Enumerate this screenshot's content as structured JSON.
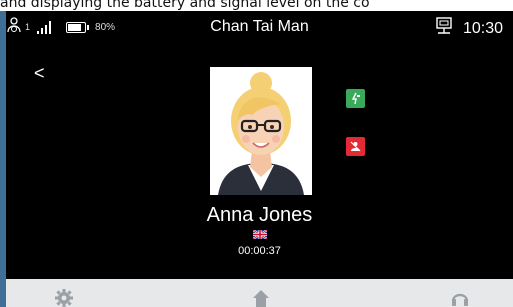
{
  "caption": "and displaying the battery and signal level on the co",
  "status": {
    "sub_count": "1",
    "battery": "80%",
    "battery_level": 0.8,
    "title": "Chan Tai Man",
    "time": "10:30"
  },
  "call": {
    "back": "<",
    "caller_name": "Anna Jones",
    "duration": "00:00:37"
  },
  "colors": {
    "unlock": "#3aa95a",
    "hangup": "#e32b35",
    "bottom_bar": "#e6e8ea"
  },
  "icons": [
    "user-icon",
    "signal-icon",
    "battery-icon",
    "network-icon",
    "back-icon",
    "unlock-icon",
    "hangup-icon",
    "flag-icon",
    "settings-icon",
    "home-icon",
    "headset-icon"
  ]
}
